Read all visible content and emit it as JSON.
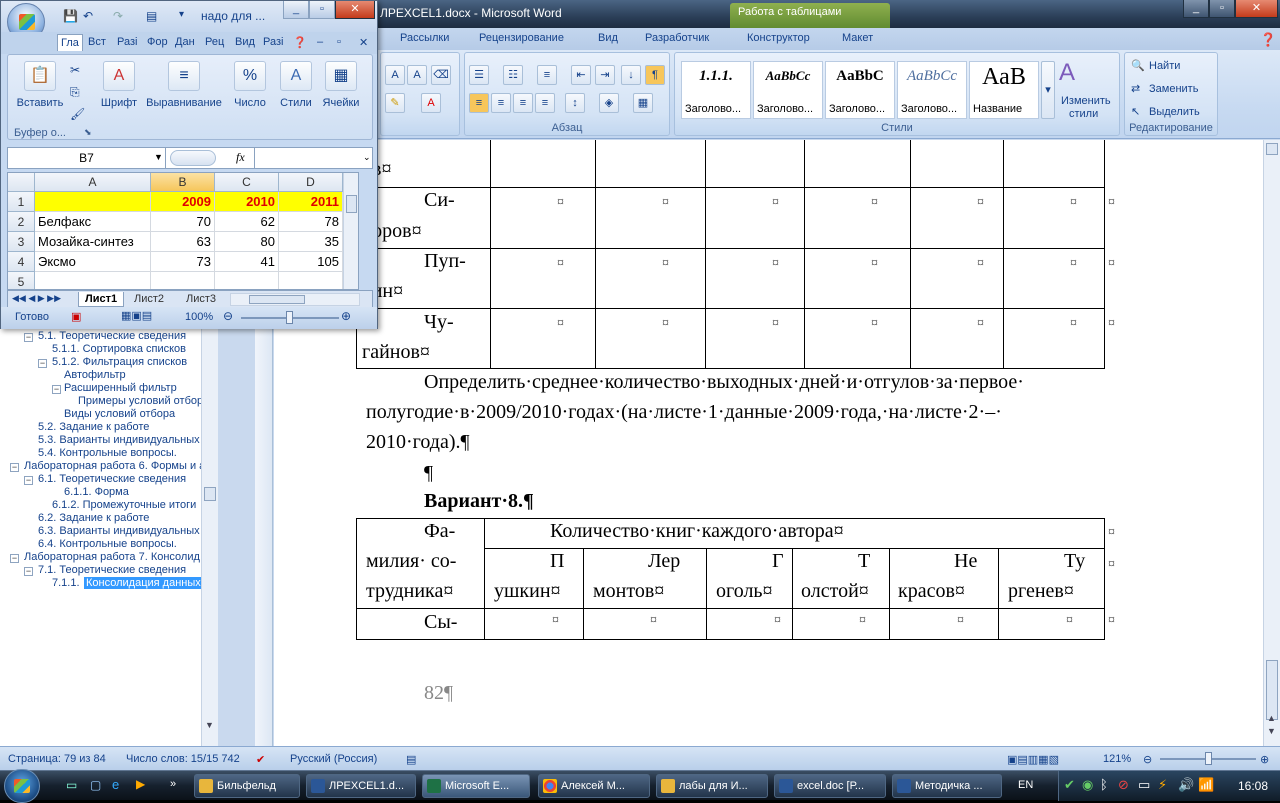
{
  "word": {
    "title": "ЛРEXCEL1.docx - Microsoft Word",
    "context_tab": "Работа с таблицами",
    "tabs": [
      "Рассылки",
      "Рецензирование",
      "Вид",
      "Разработчик",
      "Конструктор",
      "Макет"
    ],
    "ribbon": {
      "paragraph_label": "Абзац",
      "styles_label": "Стили",
      "editing_label": "Редактирование",
      "styles": [
        {
          "preview": "1.1.1.",
          "name": "Заголово..."
        },
        {
          "preview": "AaBbCc",
          "name": "Заголово..."
        },
        {
          "preview": "AaBbC",
          "name": "Заголово..."
        },
        {
          "preview": "AaBbCc",
          "name": "Заголово..."
        },
        {
          "preview": "АаВ",
          "name": "Название"
        }
      ],
      "change_styles_1": "Изменить",
      "change_styles_2": "стили",
      "find": "Найти",
      "replace": "Заменить",
      "select": "Выделить"
    },
    "nav": [
      {
        "text": "5.1. Теоретические сведения"
      },
      {
        "text": "5.1.1. Сортировка списков"
      },
      {
        "text": "5.1.2. Фильтрация списков"
      },
      {
        "text": "Автофильтр"
      },
      {
        "text": "Расширенный фильтр"
      },
      {
        "text": "Примеры условий отбор"
      },
      {
        "text": "Виды условий отбора"
      },
      {
        "text": "5.2. Задание к работе"
      },
      {
        "text": "5.3. Варианты индивидуальных"
      },
      {
        "text": "5.4. Контрольные вопросы."
      },
      {
        "text": "Лабораторная работа 6. Формы и а"
      },
      {
        "text": "6.1. Теоретические сведения"
      },
      {
        "text": "6.1.1. Форма"
      },
      {
        "text": "6.1.2. Промежуточные итоги"
      },
      {
        "text": "6.2. Задание к работе"
      },
      {
        "text": "6.3. Варианты индивидуальных"
      },
      {
        "text": "6.4. Контрольные вопросы."
      },
      {
        "text": "Лабораторная работа 7. Консолид"
      },
      {
        "text": "7.1. Теоретические сведения"
      },
      {
        "text": "7.1.1."
      },
      {
        "text": "Консолидация данных"
      }
    ],
    "doc": {
      "r0": "ов¤",
      "r1a": "Си-",
      "r1b": "доров¤",
      "r2a": "Пуп-",
      "r2b": "кин¤",
      "r3a": "Чу-",
      "r3b": "гайнов¤",
      "cell": "¤",
      "p1": "Определить·среднее·количество·выходных·дней·и·отгулов·за·первое·",
      "p2": "полугодие·в·2009/2010·годах·(на·листе·1·данные·2009·года,·на·листе·2·–·",
      "p3": "2010·года).¶",
      "pilcrow": "¶",
      "variant": "Вариант·8.¶",
      "t2_h1a": "Фа-",
      "t2_h1b": "милия· со-",
      "t2_h1c": "трудника¤",
      "t2_span": "Количество·книг·каждого·автора¤",
      "authors": [
        [
          "П",
          "ушкин¤"
        ],
        [
          "Лер",
          "монтов¤"
        ],
        [
          "Г",
          "оголь¤"
        ],
        [
          "Т",
          "олстой¤"
        ],
        [
          "Не",
          "красов¤"
        ],
        [
          "Ту",
          "ргенев¤"
        ]
      ],
      "t2_r1": "Сы-",
      "page_num": "82¶"
    },
    "status": {
      "page": "Страница: 79 из 84",
      "words": "Число слов: 15/15 742",
      "lang": "Русский (Россия)",
      "zoom": "121%"
    }
  },
  "excel": {
    "title": "надо для ...",
    "tabs": [
      "Гла",
      "Вст",
      "Разі",
      "Фор",
      "Дан",
      "Рец",
      "Вид",
      "Разі"
    ],
    "buttons": [
      "Вставить",
      "Шрифт",
      "Выравнивание",
      "Число",
      "Стили",
      "Ячейки"
    ],
    "clipboard": "Буфер о...",
    "namebox": "B7",
    "fx": "fx",
    "columns": [
      "A",
      "B",
      "C",
      "D"
    ],
    "rows": [
      {
        "n": "1",
        "a": "",
        "b": "2009",
        "c": "2010",
        "d": "2011"
      },
      {
        "n": "2",
        "a": "Белфакс",
        "b": "70",
        "c": "62",
        "d": "78"
      },
      {
        "n": "3",
        "a": "Мозайка-синтез",
        "b": "63",
        "c": "80",
        "d": "35"
      },
      {
        "n": "4",
        "a": "Эксмо",
        "b": "73",
        "c": "41",
        "d": "105"
      },
      {
        "n": "5",
        "a": "",
        "b": "",
        "c": "",
        "d": ""
      }
    ],
    "sheets": [
      "Лист1",
      "Лист2",
      "Лист3"
    ],
    "status": "Готово",
    "zoom": "100%"
  },
  "taskbar": {
    "items": [
      "Бильфельд",
      "ЛРEXCEL1.d...",
      "Microsoft E...",
      "Алексей М...",
      "лабы для И...",
      "excel.doc [Р...",
      "Методичка ..."
    ],
    "lang": "EN",
    "time": "16:08"
  }
}
